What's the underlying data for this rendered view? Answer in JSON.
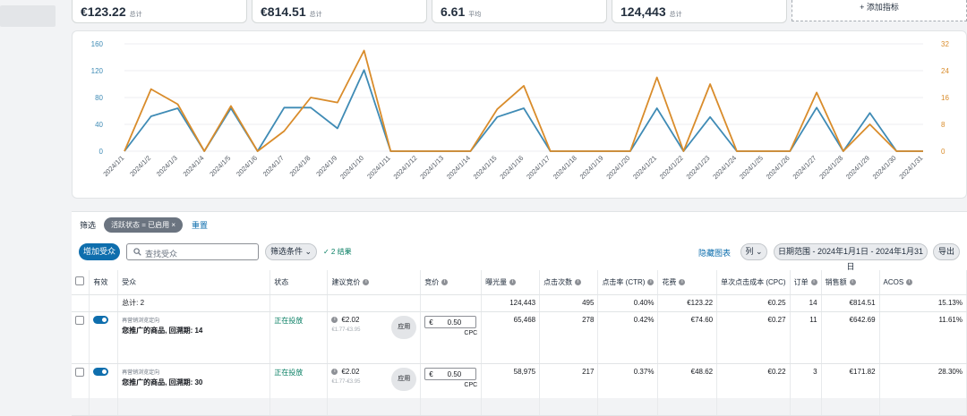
{
  "metrics": [
    {
      "value": "€123.22",
      "sub": "总计"
    },
    {
      "value": "€814.51",
      "sub": "总计"
    },
    {
      "value": "6.61",
      "sub": "平均"
    },
    {
      "value": "124,443",
      "sub": "总计"
    }
  ],
  "add_metric_label": "+ 添加指标",
  "chart_data": {
    "type": "line",
    "x": [
      "2024/1/1",
      "2024/1/2",
      "2024/1/3",
      "2024/1/4",
      "2024/1/5",
      "2024/1/6",
      "2024/1/7",
      "2024/1/8",
      "2024/1/9",
      "2024/1/10",
      "2024/1/11",
      "2024/1/12",
      "2024/1/13",
      "2024/1/14",
      "2024/1/15",
      "2024/1/16",
      "2024/1/17",
      "2024/1/18",
      "2024/1/19",
      "2024/1/20",
      "2024/1/21",
      "2024/1/22",
      "2024/1/23",
      "2024/1/24",
      "2024/1/25",
      "2024/1/26",
      "2024/1/27",
      "2024/1/28",
      "2024/1/29",
      "2024/1/30",
      "2024/1/31"
    ],
    "left_axis": {
      "ylim": [
        0,
        160
      ],
      "ticks": [
        "0",
        "40",
        "80",
        "120",
        "160"
      ]
    },
    "right_axis": {
      "ylim": [
        0,
        32
      ],
      "ticks": [
        "0",
        "8",
        "16",
        "24",
        "32"
      ]
    },
    "series": [
      {
        "axis": "left",
        "color": "#3f8bb5",
        "values": [
          0,
          52,
          64,
          0,
          64,
          0,
          65,
          65,
          34,
          121,
          0,
          0,
          0,
          0,
          51,
          64,
          0,
          0,
          0,
          0,
          64,
          0,
          51,
          0,
          0,
          0,
          65,
          0,
          57,
          0,
          0
        ]
      },
      {
        "axis": "right",
        "color": "#d98c2b",
        "values": [
          0,
          18.5,
          14,
          0,
          13.5,
          0,
          6,
          16,
          14.5,
          30,
          0,
          0,
          0,
          0,
          12.5,
          19.5,
          0,
          0,
          0,
          0,
          22,
          0,
          20,
          0,
          0,
          0,
          17.5,
          0,
          8,
          0,
          0
        ]
      }
    ],
    "grid": true
  },
  "filter": {
    "label": "筛选",
    "chip": "活跃状态 = 已启用 ×",
    "reset": "重置"
  },
  "toolbar": {
    "add_target": "增加受众",
    "search_placeholder": "查找受众",
    "filter_conditions": "筛选条件",
    "results": "✓ 2 结果",
    "hide_chart": "隐藏图表",
    "columns": "列",
    "date_range": "日期范围 - 2024年1月1日 - 2024年1月31日",
    "export": "导出"
  },
  "table": {
    "headers": {
      "active": "有效",
      "target": "受众",
      "status": "状态",
      "suggested_bid": "建议竞价",
      "bid": "竞价",
      "impressions": "曝光量",
      "clicks": "点击次数",
      "ctr": "点击率 (CTR)",
      "spend": "花费",
      "cpc": "单次点击成本 (CPC)",
      "orders": "订单",
      "sales": "销售额",
      "acos": "ACOS"
    },
    "total": {
      "label": "总计: 2",
      "impressions": "124,443",
      "clicks": "495",
      "ctr": "0.40%",
      "spend": "€123.22",
      "cpc": "€0.25",
      "orders": "14",
      "sales": "€814.51",
      "acos": "15.13%"
    },
    "rows": [
      {
        "tgt_type": "再营销浏览定向",
        "tgt_name": "您推广的商品, 回溯期: 14",
        "status": "正在投放",
        "sugg_bid": "€2.02",
        "sugg_range": "€1.77-€3.95",
        "apply": "应用",
        "bid_currency": "€",
        "bid": "0.50",
        "bid_unit": "CPC",
        "impressions": "65,468",
        "clicks": "278",
        "ctr": "0.42%",
        "spend": "€74.60",
        "cpc": "€0.27",
        "orders": "11",
        "sales": "€642.69",
        "acos": "11.61%"
      },
      {
        "tgt_type": "再营销浏览定向",
        "tgt_name": "您推广的商品, 回溯期: 30",
        "status": "正在投放",
        "sugg_bid": "€2.02",
        "sugg_range": "€1.77-€3.95",
        "apply": "应用",
        "bid_currency": "€",
        "bid": "0.50",
        "bid_unit": "CPC",
        "impressions": "58,975",
        "clicks": "217",
        "ctr": "0.37%",
        "spend": "€48.62",
        "cpc": "€0.22",
        "orders": "3",
        "sales": "€171.82",
        "acos": "28.30%"
      }
    ]
  }
}
